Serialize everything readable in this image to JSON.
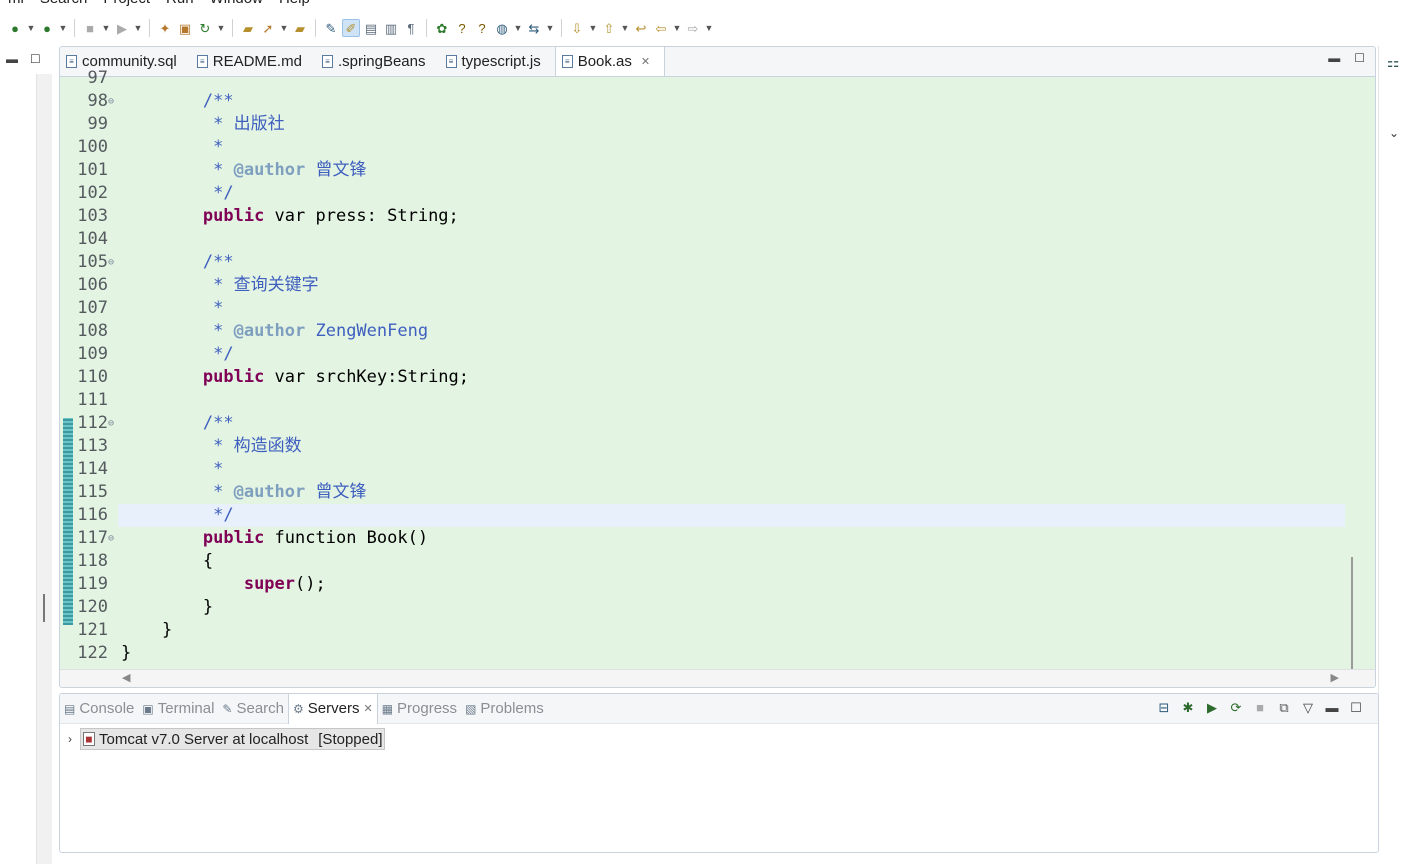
{
  "menu": [
    "ml",
    "Search",
    "Project",
    "Run",
    "Window",
    "Help"
  ],
  "editor": {
    "tabs": [
      {
        "label": "community.sql",
        "icon": "sql-file-icon",
        "active": false
      },
      {
        "label": "README.md",
        "icon": "markdown-file-icon",
        "active": false
      },
      {
        "label": ".springBeans",
        "icon": "text-file-icon",
        "active": false
      },
      {
        "label": "typescript.js",
        "icon": "js-file-icon",
        "active": false
      },
      {
        "label": "Book.as",
        "icon": "as-file-icon",
        "active": true
      }
    ],
    "lines": [
      {
        "n": "97",
        "code": ""
      },
      {
        "n": "98",
        "code": "        /**"
      },
      {
        "n": "99",
        "code": "         * 出版社"
      },
      {
        "n": "100",
        "code": "         *"
      },
      {
        "n": "101",
        "code": "         * @author 曾文锋"
      },
      {
        "n": "102",
        "code": "         */"
      },
      {
        "n": "103",
        "code": "        public var press: String;"
      },
      {
        "n": "104",
        "code": ""
      },
      {
        "n": "105",
        "code": "        /**"
      },
      {
        "n": "106",
        "code": "         * 查询关键字"
      },
      {
        "n": "107",
        "code": "         *"
      },
      {
        "n": "108",
        "code": "         * @author ZengWenFeng"
      },
      {
        "n": "109",
        "code": "         */"
      },
      {
        "n": "110",
        "code": "        public var srchKey:String;"
      },
      {
        "n": "111",
        "code": ""
      },
      {
        "n": "112",
        "code": "        /**"
      },
      {
        "n": "113",
        "code": "         * 构造函数"
      },
      {
        "n": "114",
        "code": "         *"
      },
      {
        "n": "115",
        "code": "         * @author 曾文锋"
      },
      {
        "n": "116",
        "code": "         */"
      },
      {
        "n": "117",
        "code": "        public function Book()"
      },
      {
        "n": "118",
        "code": "        {"
      },
      {
        "n": "119",
        "code": "            super();"
      },
      {
        "n": "120",
        "code": "        }"
      },
      {
        "n": "121",
        "code": "    }"
      },
      {
        "n": "122",
        "code": "}"
      }
    ],
    "fold_lines": [
      "98",
      "105",
      "112",
      "117"
    ],
    "current_line": "116"
  },
  "bottom": {
    "tabs": [
      {
        "label": "Console",
        "active": false
      },
      {
        "label": "Terminal",
        "active": false
      },
      {
        "label": "Search",
        "active": false
      },
      {
        "label": "Servers",
        "active": true
      },
      {
        "label": "Progress",
        "active": false
      },
      {
        "label": "Problems",
        "active": false
      }
    ],
    "server": {
      "name": "Tomcat v7.0 Server at localhost",
      "status": "[Stopped]"
    }
  },
  "colors": {
    "editor_bg": "#e3f4e3",
    "keyword": "#7f0055",
    "comment": "#3f5fbf",
    "javadoc_tag": "#7f9fbf",
    "current_line": "#e8f1fb"
  }
}
